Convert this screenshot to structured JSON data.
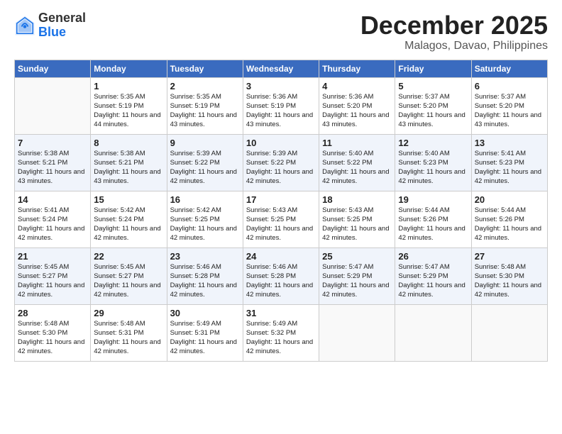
{
  "logo": {
    "general": "General",
    "blue": "Blue"
  },
  "title": "December 2025",
  "location": "Malagos, Davao, Philippines",
  "headers": [
    "Sunday",
    "Monday",
    "Tuesday",
    "Wednesday",
    "Thursday",
    "Friday",
    "Saturday"
  ],
  "weeks": [
    [
      {
        "day": "",
        "sunrise": "",
        "sunset": "",
        "daylight": ""
      },
      {
        "day": "1",
        "sunrise": "Sunrise: 5:35 AM",
        "sunset": "Sunset: 5:19 PM",
        "daylight": "Daylight: 11 hours and 44 minutes."
      },
      {
        "day": "2",
        "sunrise": "Sunrise: 5:35 AM",
        "sunset": "Sunset: 5:19 PM",
        "daylight": "Daylight: 11 hours and 43 minutes."
      },
      {
        "day": "3",
        "sunrise": "Sunrise: 5:36 AM",
        "sunset": "Sunset: 5:19 PM",
        "daylight": "Daylight: 11 hours and 43 minutes."
      },
      {
        "day": "4",
        "sunrise": "Sunrise: 5:36 AM",
        "sunset": "Sunset: 5:20 PM",
        "daylight": "Daylight: 11 hours and 43 minutes."
      },
      {
        "day": "5",
        "sunrise": "Sunrise: 5:37 AM",
        "sunset": "Sunset: 5:20 PM",
        "daylight": "Daylight: 11 hours and 43 minutes."
      },
      {
        "day": "6",
        "sunrise": "Sunrise: 5:37 AM",
        "sunset": "Sunset: 5:20 PM",
        "daylight": "Daylight: 11 hours and 43 minutes."
      }
    ],
    [
      {
        "day": "7",
        "sunrise": "Sunrise: 5:38 AM",
        "sunset": "Sunset: 5:21 PM",
        "daylight": "Daylight: 11 hours and 43 minutes."
      },
      {
        "day": "8",
        "sunrise": "Sunrise: 5:38 AM",
        "sunset": "Sunset: 5:21 PM",
        "daylight": "Daylight: 11 hours and 43 minutes."
      },
      {
        "day": "9",
        "sunrise": "Sunrise: 5:39 AM",
        "sunset": "Sunset: 5:22 PM",
        "daylight": "Daylight: 11 hours and 42 minutes."
      },
      {
        "day": "10",
        "sunrise": "Sunrise: 5:39 AM",
        "sunset": "Sunset: 5:22 PM",
        "daylight": "Daylight: 11 hours and 42 minutes."
      },
      {
        "day": "11",
        "sunrise": "Sunrise: 5:40 AM",
        "sunset": "Sunset: 5:22 PM",
        "daylight": "Daylight: 11 hours and 42 minutes."
      },
      {
        "day": "12",
        "sunrise": "Sunrise: 5:40 AM",
        "sunset": "Sunset: 5:23 PM",
        "daylight": "Daylight: 11 hours and 42 minutes."
      },
      {
        "day": "13",
        "sunrise": "Sunrise: 5:41 AM",
        "sunset": "Sunset: 5:23 PM",
        "daylight": "Daylight: 11 hours and 42 minutes."
      }
    ],
    [
      {
        "day": "14",
        "sunrise": "Sunrise: 5:41 AM",
        "sunset": "Sunset: 5:24 PM",
        "daylight": "Daylight: 11 hours and 42 minutes."
      },
      {
        "day": "15",
        "sunrise": "Sunrise: 5:42 AM",
        "sunset": "Sunset: 5:24 PM",
        "daylight": "Daylight: 11 hours and 42 minutes."
      },
      {
        "day": "16",
        "sunrise": "Sunrise: 5:42 AM",
        "sunset": "Sunset: 5:25 PM",
        "daylight": "Daylight: 11 hours and 42 minutes."
      },
      {
        "day": "17",
        "sunrise": "Sunrise: 5:43 AM",
        "sunset": "Sunset: 5:25 PM",
        "daylight": "Daylight: 11 hours and 42 minutes."
      },
      {
        "day": "18",
        "sunrise": "Sunrise: 5:43 AM",
        "sunset": "Sunset: 5:25 PM",
        "daylight": "Daylight: 11 hours and 42 minutes."
      },
      {
        "day": "19",
        "sunrise": "Sunrise: 5:44 AM",
        "sunset": "Sunset: 5:26 PM",
        "daylight": "Daylight: 11 hours and 42 minutes."
      },
      {
        "day": "20",
        "sunrise": "Sunrise: 5:44 AM",
        "sunset": "Sunset: 5:26 PM",
        "daylight": "Daylight: 11 hours and 42 minutes."
      }
    ],
    [
      {
        "day": "21",
        "sunrise": "Sunrise: 5:45 AM",
        "sunset": "Sunset: 5:27 PM",
        "daylight": "Daylight: 11 hours and 42 minutes."
      },
      {
        "day": "22",
        "sunrise": "Sunrise: 5:45 AM",
        "sunset": "Sunset: 5:27 PM",
        "daylight": "Daylight: 11 hours and 42 minutes."
      },
      {
        "day": "23",
        "sunrise": "Sunrise: 5:46 AM",
        "sunset": "Sunset: 5:28 PM",
        "daylight": "Daylight: 11 hours and 42 minutes."
      },
      {
        "day": "24",
        "sunrise": "Sunrise: 5:46 AM",
        "sunset": "Sunset: 5:28 PM",
        "daylight": "Daylight: 11 hours and 42 minutes."
      },
      {
        "day": "25",
        "sunrise": "Sunrise: 5:47 AM",
        "sunset": "Sunset: 5:29 PM",
        "daylight": "Daylight: 11 hours and 42 minutes."
      },
      {
        "day": "26",
        "sunrise": "Sunrise: 5:47 AM",
        "sunset": "Sunset: 5:29 PM",
        "daylight": "Daylight: 11 hours and 42 minutes."
      },
      {
        "day": "27",
        "sunrise": "Sunrise: 5:48 AM",
        "sunset": "Sunset: 5:30 PM",
        "daylight": "Daylight: 11 hours and 42 minutes."
      }
    ],
    [
      {
        "day": "28",
        "sunrise": "Sunrise: 5:48 AM",
        "sunset": "Sunset: 5:30 PM",
        "daylight": "Daylight: 11 hours and 42 minutes."
      },
      {
        "day": "29",
        "sunrise": "Sunrise: 5:48 AM",
        "sunset": "Sunset: 5:31 PM",
        "daylight": "Daylight: 11 hours and 42 minutes."
      },
      {
        "day": "30",
        "sunrise": "Sunrise: 5:49 AM",
        "sunset": "Sunset: 5:31 PM",
        "daylight": "Daylight: 11 hours and 42 minutes."
      },
      {
        "day": "31",
        "sunrise": "Sunrise: 5:49 AM",
        "sunset": "Sunset: 5:32 PM",
        "daylight": "Daylight: 11 hours and 42 minutes."
      },
      {
        "day": "",
        "sunrise": "",
        "sunset": "",
        "daylight": ""
      },
      {
        "day": "",
        "sunrise": "",
        "sunset": "",
        "daylight": ""
      },
      {
        "day": "",
        "sunrise": "",
        "sunset": "",
        "daylight": ""
      }
    ]
  ]
}
